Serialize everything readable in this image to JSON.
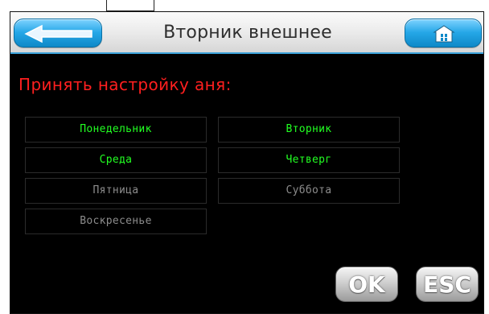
{
  "header": {
    "title": "Вторник внешнее",
    "back_icon": "back-arrow-icon",
    "home_icon": "home-icon",
    "accent_color": "#25a7e7"
  },
  "prompt": {
    "text": "Принять настройку аня:",
    "color": "#ff1f1f"
  },
  "days": [
    {
      "label": "Понедельник",
      "active": true
    },
    {
      "label": "Вторник",
      "active": true
    },
    {
      "label": "Среда",
      "active": true
    },
    {
      "label": "Четверг",
      "active": true
    },
    {
      "label": "Пятница",
      "active": false
    },
    {
      "label": "Суббота",
      "active": false
    },
    {
      "label": "Воскресенье",
      "active": false
    }
  ],
  "actions": {
    "ok_label": "OK",
    "esc_label": "ESC"
  },
  "colors": {
    "active_day": "#22ff22",
    "inactive_day": "#8c8c8c",
    "screen_bg": "#000000"
  }
}
